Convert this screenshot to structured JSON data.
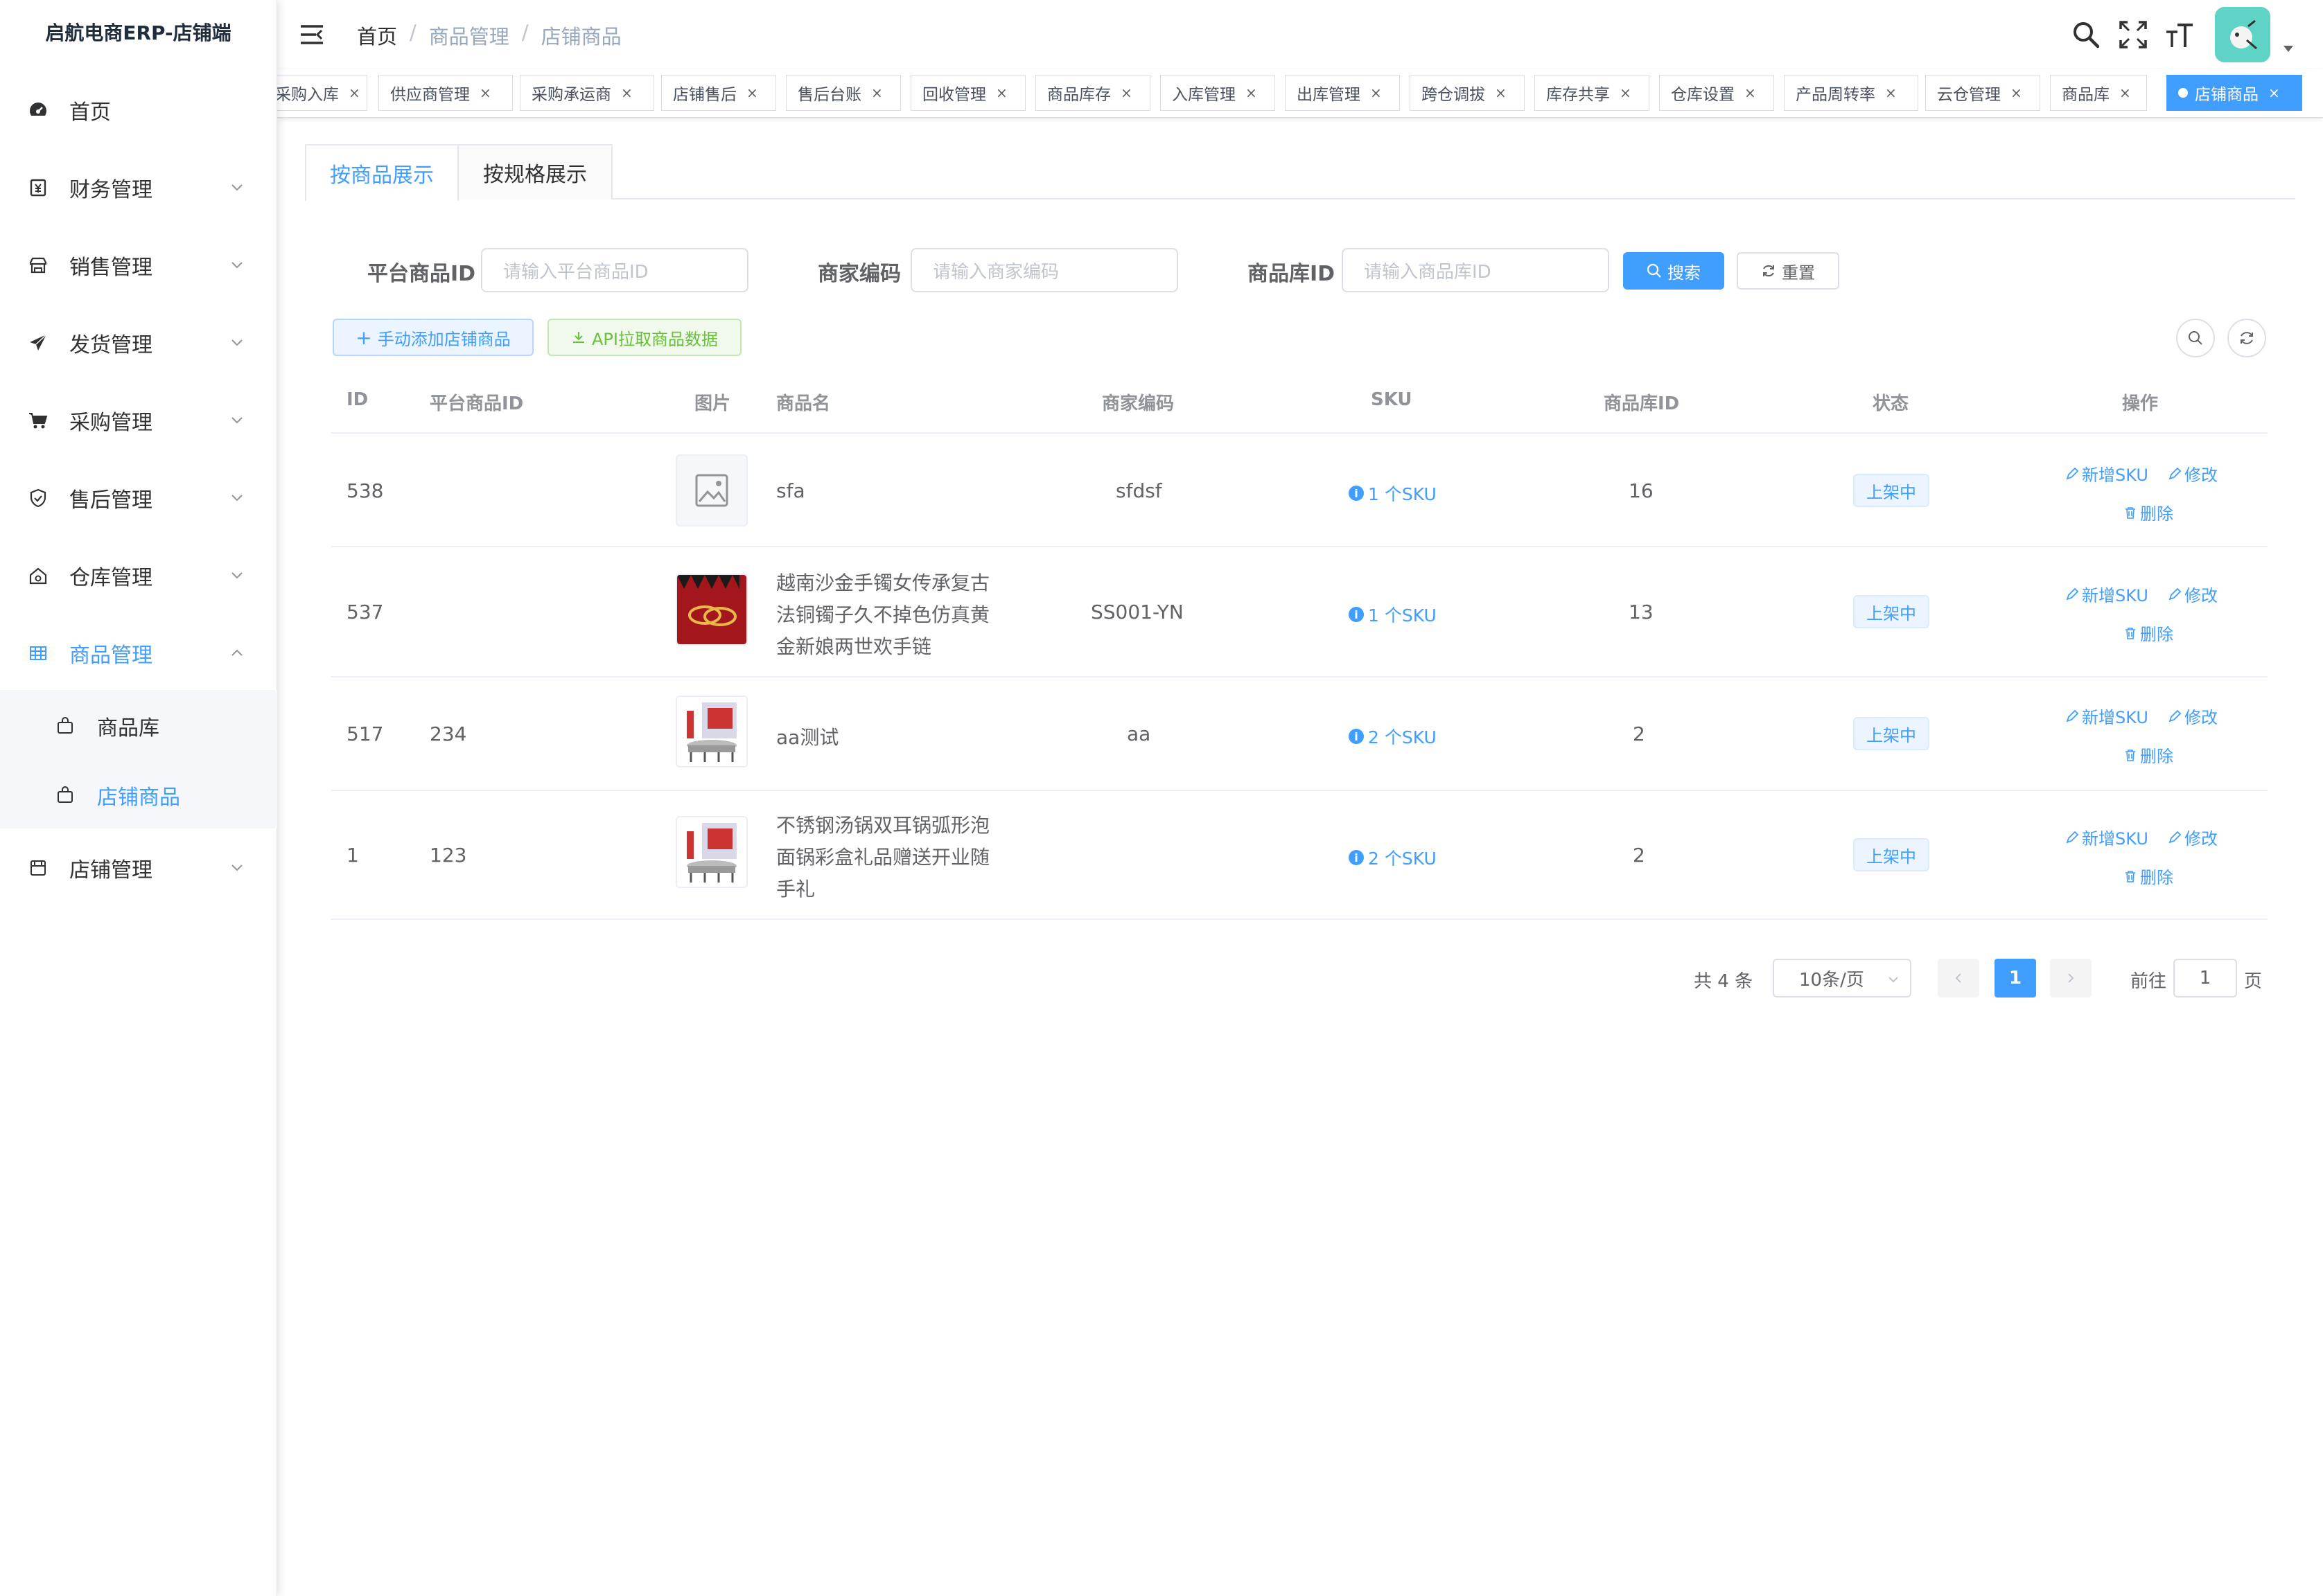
{
  "sidebar": {
    "title": "启航电商ERP-店铺端",
    "items": [
      {
        "label": "首页"
      },
      {
        "label": "财务管理"
      },
      {
        "label": "销售管理"
      },
      {
        "label": "发货管理"
      },
      {
        "label": "采购管理"
      },
      {
        "label": "售后管理"
      },
      {
        "label": "仓库管理"
      },
      {
        "label": "商品管理"
      },
      {
        "label": "店铺管理"
      }
    ],
    "sub_items": [
      {
        "label": "商品库"
      },
      {
        "label": "店铺商品"
      }
    ]
  },
  "breadcrumb": [
    "首页",
    "商品管理",
    "店铺商品"
  ],
  "tags": [
    {
      "label": "采购入库"
    },
    {
      "label": "供应商管理"
    },
    {
      "label": "采购承运商"
    },
    {
      "label": "店铺售后"
    },
    {
      "label": "售后台账"
    },
    {
      "label": "回收管理"
    },
    {
      "label": "商品库存"
    },
    {
      "label": "入库管理"
    },
    {
      "label": "出库管理"
    },
    {
      "label": "跨仓调拔"
    },
    {
      "label": "库存共享"
    },
    {
      "label": "仓库设置"
    },
    {
      "label": "产品周转率"
    },
    {
      "label": "云仓管理"
    },
    {
      "label": "商品库"
    },
    {
      "label": "店铺商品"
    }
  ],
  "tag_close": "×",
  "tabs": [
    "按商品展示",
    "按规格展示"
  ],
  "filters": {
    "platform_id": {
      "label": "平台商品ID",
      "placeholder": "请输入平台商品ID"
    },
    "merchant_code": {
      "label": "商家编码",
      "placeholder": "请输入商家编码"
    },
    "library_id": {
      "label": "商品库ID",
      "placeholder": "请输入商品库ID"
    }
  },
  "buttons": {
    "search": "搜索",
    "reset": "重置",
    "add": "手动添加店铺商品",
    "api_pull": "API拉取商品数据"
  },
  "table": {
    "columns": [
      "ID",
      "平台商品ID",
      "图片",
      "商品名",
      "商家编码",
      "SKU",
      "商品库ID",
      "状态",
      "操作"
    ],
    "rows": [
      {
        "id": "538",
        "platform_id": "",
        "name_lines": [
          "sfa"
        ],
        "code": "sfdsf",
        "sku": "1 个SKU",
        "lib_id": "16",
        "status": "上架中"
      },
      {
        "id": "537",
        "platform_id": "",
        "name_lines": [
          "越南沙金手镯女传承复古",
          "法铜镯子久不掉色仿真黄",
          "金新娘两世欢手链"
        ],
        "code": "SS001-YN",
        "sku": "1 个SKU",
        "lib_id": "13",
        "status": "上架中"
      },
      {
        "id": "517",
        "platform_id": "234",
        "name_lines": [
          "aa测试"
        ],
        "code": "aa",
        "sku": "2 个SKU",
        "lib_id": "2",
        "status": "上架中"
      },
      {
        "id": "1",
        "platform_id": "123",
        "name_lines": [
          "不锈钢汤锅双耳锅弧形泡",
          "面锅彩盒礼品赠送开业随",
          "手礼"
        ],
        "code": "",
        "sku": "2 个SKU",
        "lib_id": "2",
        "status": "上架中"
      }
    ],
    "ops": {
      "add_sku": "新增SKU",
      "edit": "修改",
      "delete": "删除"
    }
  },
  "pagination": {
    "total": "共 4 条",
    "page_size": "10条/页",
    "current": "1",
    "goto_prefix": "前往",
    "goto_value": "1",
    "goto_suffix": "页"
  },
  "colors": {
    "primary": "#409eff",
    "success": "#67c23a",
    "avatar": "#5fd3c6"
  }
}
